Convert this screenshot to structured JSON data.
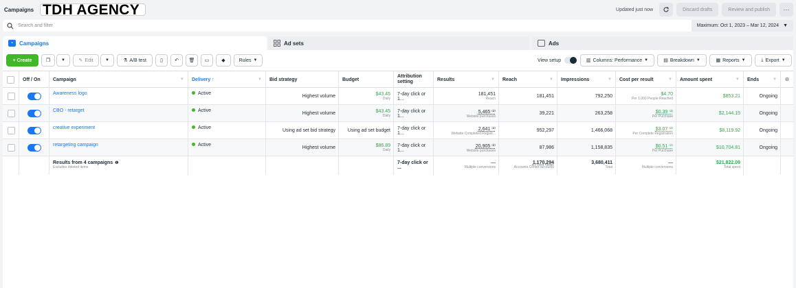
{
  "topbar": {
    "title": "Campaigns",
    "agency_name": "TDH AGENCY",
    "updated": "Updated just now",
    "discard": "Discard drafts",
    "review": "Review and publish",
    "more": "···"
  },
  "search": {
    "placeholder": "Search and filter",
    "date_range": "Maximum: Oct 1, 2023 – Mar 12, 2024"
  },
  "tabs": [
    {
      "label": "Campaigns"
    },
    {
      "label": "Ad sets"
    },
    {
      "label": "Ads"
    }
  ],
  "toolbar": {
    "create": "+ Create",
    "edit": "Edit",
    "ab_test": "A/B test",
    "rules": "Rules",
    "view_setup": "View setup",
    "columns": "Columns: Performance",
    "breakdown": "Breakdown",
    "reports": "Reports",
    "export": "Export"
  },
  "columns": [
    "Off / On",
    "Campaign",
    "Delivery ↑",
    "Bid strategy",
    "Budget",
    "Attribution setting",
    "Results",
    "Reach",
    "Impressions",
    "Cost per result",
    "Amount spent",
    "Ends"
  ],
  "rows": [
    {
      "campaign": "Awareness logo",
      "delivery": "Active",
      "bid": "Highest volume",
      "budget": "$43.45",
      "budget_sub": "Daily",
      "attribution": "7-day click or 1...",
      "results": "181,451",
      "results_sub": "Reach",
      "reach": "181,451",
      "impressions": "792,250",
      "cpr": "$4.70",
      "cpr_sub": "Per 1,000 People Reached",
      "spent": "$853.21",
      "ends": "Ongoing"
    },
    {
      "campaign": "CBO - retarget",
      "delivery": "Active",
      "bid": "Highest volume",
      "budget": "$43.45",
      "budget_sub": "Daily",
      "attribution": "7-day click or 1...",
      "results": "5,465 ⁽²⁾",
      "results_sub": "Website purchases",
      "reach": "39,221",
      "impressions": "263,258",
      "cpr": "$0.39 ⁽²⁾",
      "cpr_sub": "Per Purchase",
      "spent": "$2,144.15",
      "ends": "Ongoing"
    },
    {
      "campaign": "creative experiment",
      "delivery": "Active",
      "bid": "Using ad set bid strategy",
      "budget": "Using ad set budget",
      "budget_sub": "",
      "attribution": "7-day click or 1...",
      "results": "2,641 ⁽²⁾",
      "results_sub": "Website Completed Registr...",
      "reach": "952,297",
      "impressions": "1,466,068",
      "cpr": "$3.07 ⁽²⁾",
      "cpr_sub": "Per Complete Registration",
      "spent": "$8,119.92",
      "ends": "Ongoing"
    },
    {
      "campaign": "retargeting campaign",
      "delivery": "Active",
      "bid": "Highest volume",
      "budget": "$86.89",
      "budget_sub": "Daily",
      "attribution": "7-day click or 1...",
      "results": "20,905 ⁽²⁾",
      "results_sub": "Website purchases",
      "reach": "87,986",
      "impressions": "1,158,835",
      "cpr": "$0.51 ⁽²⁾",
      "cpr_sub": "Per Purchase",
      "spent": "$10,704.81",
      "ends": "Ongoing"
    }
  ],
  "totals": {
    "label": "Results from 4 campaigns",
    "sub": "Excludes deleted items",
    "attribution": "7-day click or ...",
    "results": "—",
    "results_sub": "Multiple conversions",
    "reach": "1,170,294",
    "reach_sub": "Accounts Center accounts",
    "impressions": "3,680,411",
    "impressions_sub": "Total",
    "cpr": "—",
    "cpr_sub": "Multiple conversions",
    "spent": "$21,822.09",
    "spent_sub": "Total spent"
  },
  "colors": {
    "accent": "#1877f2",
    "create": "#42b72a",
    "money": "#2fa84f"
  }
}
